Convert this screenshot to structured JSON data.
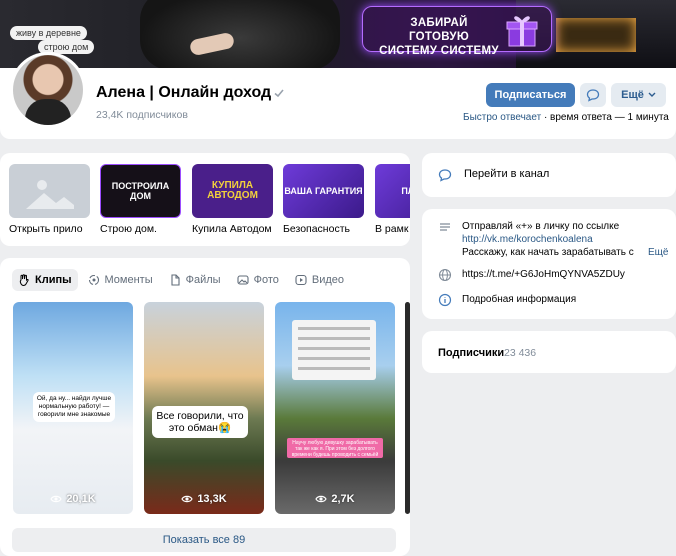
{
  "cover": {
    "tags": [
      "живу в деревне",
      "строю дом"
    ],
    "promo_text": "ЗАБИРАЙ ГОТОВУЮ СИСТЕМУ СИСТЕМУ"
  },
  "profile": {
    "name": "Алена | Онлайн доход",
    "subscribers": "23,4K подписчиков",
    "subscribe_label": "Подписаться",
    "more_label": "Ещё",
    "reply_prefix": "Быстро отвечает",
    "reply_suffix": " · время ответа — 1 минута"
  },
  "apps": [
    {
      "label": "Открыть прило",
      "thumb_text": ""
    },
    {
      "label": "Строю дом.",
      "thumb_text": "ПОСТРОИЛА ДОМ"
    },
    {
      "label": "Купила Автодом",
      "thumb_text": "КУПИЛА АВТОДОМ"
    },
    {
      "label": "Безопасность",
      "thumb_text": "ВАША ГАРАНТИЯ"
    },
    {
      "label": "В рамк",
      "thumb_text": "ПЛ НА"
    }
  ],
  "tabs": [
    {
      "label": "Клипы",
      "icon": "clips-icon",
      "active": true
    },
    {
      "label": "Моменты",
      "icon": "moments-icon",
      "active": false
    },
    {
      "label": "Файлы",
      "icon": "file-icon",
      "active": false
    },
    {
      "label": "Фото",
      "icon": "photo-icon",
      "active": false
    },
    {
      "label": "Видео",
      "icon": "video-icon",
      "active": false
    }
  ],
  "clips": [
    {
      "views": "20,1K",
      "caption": "Ой, да ну... найди лучше нормальную работу! — говорили мне знакомые"
    },
    {
      "views": "13,3K",
      "caption": "Все говорили, что это обман😭"
    },
    {
      "views": "2,7K",
      "caption": "Научу любую девушку зарабатывать так же как я. При этом без долгого времени будешь проводить с семьёй"
    }
  ],
  "show_all_label": "Показать все 89",
  "sidebar": {
    "goto_channel": "Перейти в канал",
    "info_line1": "Отправляй «+» в личку по ссылке",
    "info_link": "http://vk.me/korochenkoalena",
    "info_line3": "Расскажу, как начать зарабатывать с",
    "info_more": "Ещё",
    "tg_link": "https://t.me/+G6JoHmQYNVA5ZDUy",
    "details": "Подробная информация",
    "followers_label": "Подписчики",
    "followers_count": "23 436"
  },
  "colors": {
    "primary_button": "#447bba",
    "link": "#2a5885",
    "background": "#edeef0",
    "muted": "#818c99"
  }
}
